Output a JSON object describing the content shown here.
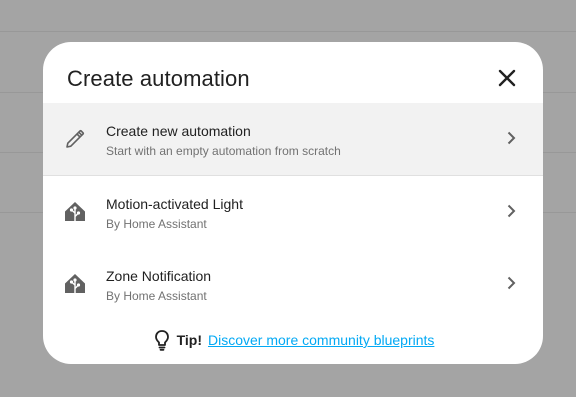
{
  "dialog": {
    "title": "Create automation",
    "close_icon": "close-icon"
  },
  "items": [
    {
      "icon": "pencil-icon",
      "primary": "Create new automation",
      "secondary": "Start with an empty automation from scratch"
    },
    {
      "icon": "home-assistant-icon",
      "primary": "Motion-activated Light",
      "secondary": "By Home Assistant"
    },
    {
      "icon": "home-assistant-icon",
      "primary": "Zone Notification",
      "secondary": "By Home Assistant"
    }
  ],
  "tip": {
    "icon": "lightbulb-icon",
    "label": "Tip!",
    "link_text": "Discover more community blueprints"
  },
  "colors": {
    "backdrop": "#a4a4a4",
    "link": "#03a9f4",
    "selected_row": "#f2f2f2"
  }
}
